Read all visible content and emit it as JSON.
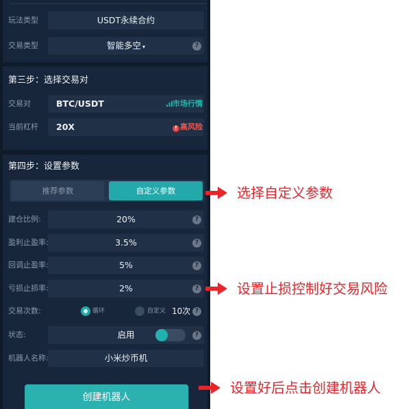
{
  "panel1": {
    "play_type": {
      "label": "玩法类型",
      "value": "USDT永续合约"
    },
    "trade_type": {
      "label": "交易类型",
      "value": "智能多空",
      "caret": "▾"
    }
  },
  "panel2": {
    "title": "第三步：选择交易对",
    "pair": {
      "label": "交易对",
      "value": "BTC/USDT",
      "link": "行情",
      "link_prefix": "市场",
      "link_icon": "chart-icon"
    },
    "leverage": {
      "label": "当前杠杆",
      "value": "20X",
      "risk": "高风险",
      "risk_icon": "!"
    }
  },
  "panel3": {
    "title": "第四步：设置参数",
    "tabs": [
      {
        "label": "推荐参数",
        "active": false
      },
      {
        "label": "自定义参数",
        "active": true
      }
    ],
    "rows": [
      {
        "label": "建仓比例:",
        "value": "20%"
      },
      {
        "label": "盈利止盈率:",
        "value": "3.5%"
      },
      {
        "label": "回调止盈率:",
        "value": "5%"
      },
      {
        "label": "亏损止损率:",
        "value": "2%"
      }
    ],
    "trade_count": {
      "label": "交易次数:",
      "option_loop": "循环",
      "option_custom": "自定义",
      "count": "10次",
      "selected": "循环"
    },
    "status": {
      "label": "状态:",
      "value": "启用",
      "enabled": true
    },
    "robot_name": {
      "label": "机器人名称:",
      "value": "小米炒币机"
    },
    "help_icon": "?"
  },
  "create_button": "创建机器人",
  "annotations": [
    "选择自定义参数",
    "设置止损控制好交易风险",
    "设置好后点击创建机器人"
  ],
  "colors": {
    "background": "#101b2a",
    "panel": "#17263a",
    "field": "#1f3047",
    "accent": "#23a9a9",
    "risk": "#e85a54",
    "annotation": "#e8262a"
  }
}
